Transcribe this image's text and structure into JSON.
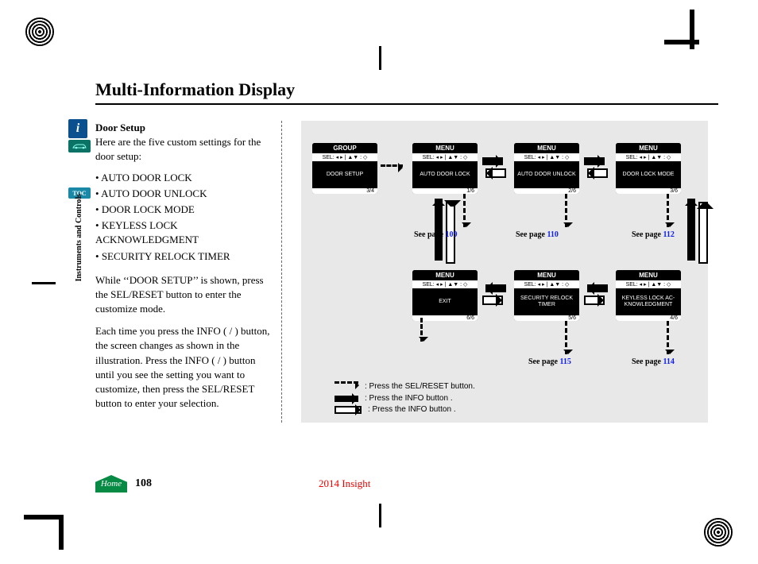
{
  "page_title": "Multi-Information Display",
  "section_label": "Instruments and Controls",
  "side_tabs": {
    "info": "i",
    "toc": "TOC"
  },
  "subheading": "Door Setup",
  "intro": "Here are the five custom settings for the door setup:",
  "bullets": [
    "AUTO DOOR LOCK",
    "AUTO DOOR UNLOCK",
    "DOOR LOCK MODE",
    "KEYLESS LOCK ACKNOWLEDGMENT",
    "SECURITY RELOCK TIMER"
  ],
  "para1": "While ‘‘DOOR SETUP’’ is shown, press the SEL/RESET button to enter the customize mode.",
  "para2": "Each time you press the INFO (      /      ) button, the screen changes as  shown in the illustration. Press the INFO (      /      ) button until you see the setting you want to customize, then press the SEL/RESET button to enter your selection.",
  "screens": {
    "start": {
      "hdr": "GROUP",
      "sel": "SEL: ◂ ▸  | ▲▼ : ◇",
      "body": "DOOR SETUP",
      "foot": "3/4"
    },
    "adl": {
      "hdr": "MENU",
      "sel": "SEL: ◂ ▸  | ▲▼ : ◇",
      "body": "AUTO DOOR LOCK",
      "foot": "1/6"
    },
    "adu": {
      "hdr": "MENU",
      "sel": "SEL: ◂ ▸  | ▲▼ : ◇",
      "body": "AUTO DOOR UNLOCK",
      "foot": "2/6"
    },
    "dlm": {
      "hdr": "MENU",
      "sel": "SEL: ◂ ▸  | ▲▼ : ◇",
      "body": "DOOR LOCK MODE",
      "foot": "3/6"
    },
    "exit": {
      "hdr": "MENU",
      "sel": "SEL: ◂ ▸  | ▲▼ : ◇",
      "body": "EXIT",
      "foot": "6/6"
    },
    "srt": {
      "hdr": "MENU",
      "sel": "SEL: ◂ ▸  | ▲▼ : ◇",
      "body": "SECURITY RELOCK TIMER",
      "foot": "5/6"
    },
    "kla": {
      "hdr": "MENU",
      "sel": "SEL: ◂ ▸  | ▲▼ : ◇",
      "body": "KEYLESS LOCK AC- KNOWLEDGMENT",
      "foot": "4/6"
    }
  },
  "seepages": {
    "adl": {
      "label": "See page",
      "num": "109"
    },
    "adu": {
      "label": "See page",
      "num": "110"
    },
    "dlm": {
      "label": "See page",
      "num": "112"
    },
    "srt": {
      "label": "See page",
      "num": "115"
    },
    "kla": {
      "label": "See page",
      "num": "114"
    }
  },
  "legend": {
    "dashed": ": Press the SEL/RESET button.",
    "solid": ": Press the INFO button      .",
    "hollow": ": Press the INFO button      ."
  },
  "footer": {
    "home": "Home",
    "page": "108",
    "vehicle": "2014 Insight"
  }
}
